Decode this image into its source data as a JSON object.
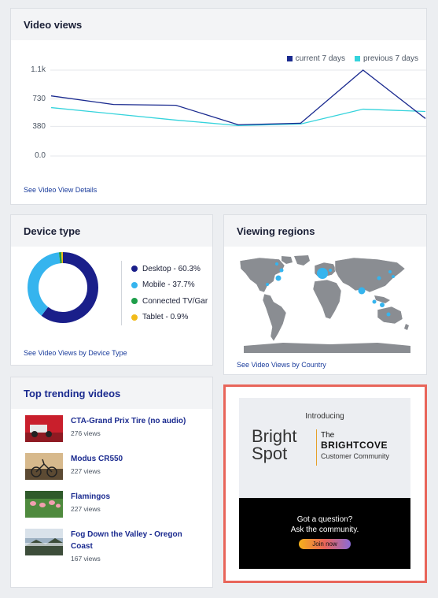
{
  "video_views": {
    "title": "Video views",
    "legend": [
      "current 7 days",
      "previous 7 days"
    ],
    "link": "See Video View Details",
    "colors": {
      "current": "#1a2a8f",
      "previous": "#35d3dc"
    },
    "chart_data": {
      "type": "line",
      "y_ticks": [
        "1.1k",
        "730",
        "380",
        "0.0"
      ],
      "ylim": [
        0,
        1100
      ],
      "x": [
        1,
        2,
        3,
        4,
        5,
        6,
        7
      ],
      "series": [
        {
          "name": "current 7 days",
          "values": [
            770,
            660,
            650,
            400,
            420,
            1100,
            480
          ]
        },
        {
          "name": "previous 7 days",
          "values": [
            620,
            540,
            460,
            390,
            410,
            600,
            570
          ]
        }
      ]
    }
  },
  "device_type": {
    "title": "Device type",
    "link": "See Video Views by Device Type",
    "chart_data": {
      "type": "pie",
      "labels": [
        "Desktop",
        "Mobile",
        "Connected TV/Game",
        "Tablet"
      ],
      "values": [
        60.3,
        37.7,
        1.1,
        0.9
      ],
      "colors": [
        "#1a1f8a",
        "#35b4ee",
        "#1e9e4a",
        "#f2bb19"
      ]
    },
    "legend": [
      "Desktop - 60.3%",
      "Mobile - 37.7%",
      "Connected TV/Gar",
      "Tablet - 0.9%"
    ]
  },
  "viewing_regions": {
    "title": "Viewing regions",
    "link": "See Video Views by Country"
  },
  "trending": {
    "title": "Top trending videos",
    "items": [
      {
        "title": "CTA-Grand Prix Tire (no audio)",
        "views": "276 views",
        "thumb_icon": "race-car-thumbnail"
      },
      {
        "title": "Modus CR550",
        "views": "227 views",
        "thumb_icon": "bicycle-thumbnail"
      },
      {
        "title": "Flamingos",
        "views": "227 views",
        "thumb_icon": "flamingos-thumbnail"
      },
      {
        "title": "Fog Down the Valley - Oregon Coast",
        "views": "167 views",
        "thumb_icon": "valley-thumbnail"
      }
    ]
  },
  "ad": {
    "introducing": "Introducing",
    "brand_left_1": "Bright",
    "brand_left_2": "Spot",
    "brand_the": "The",
    "brand_right": "BRIGHTCOVE",
    "brand_sub": "Customer Community",
    "question": "Got a question?",
    "ask": "Ask the community.",
    "cta": "Join now",
    "border_color": "#e8655a"
  }
}
